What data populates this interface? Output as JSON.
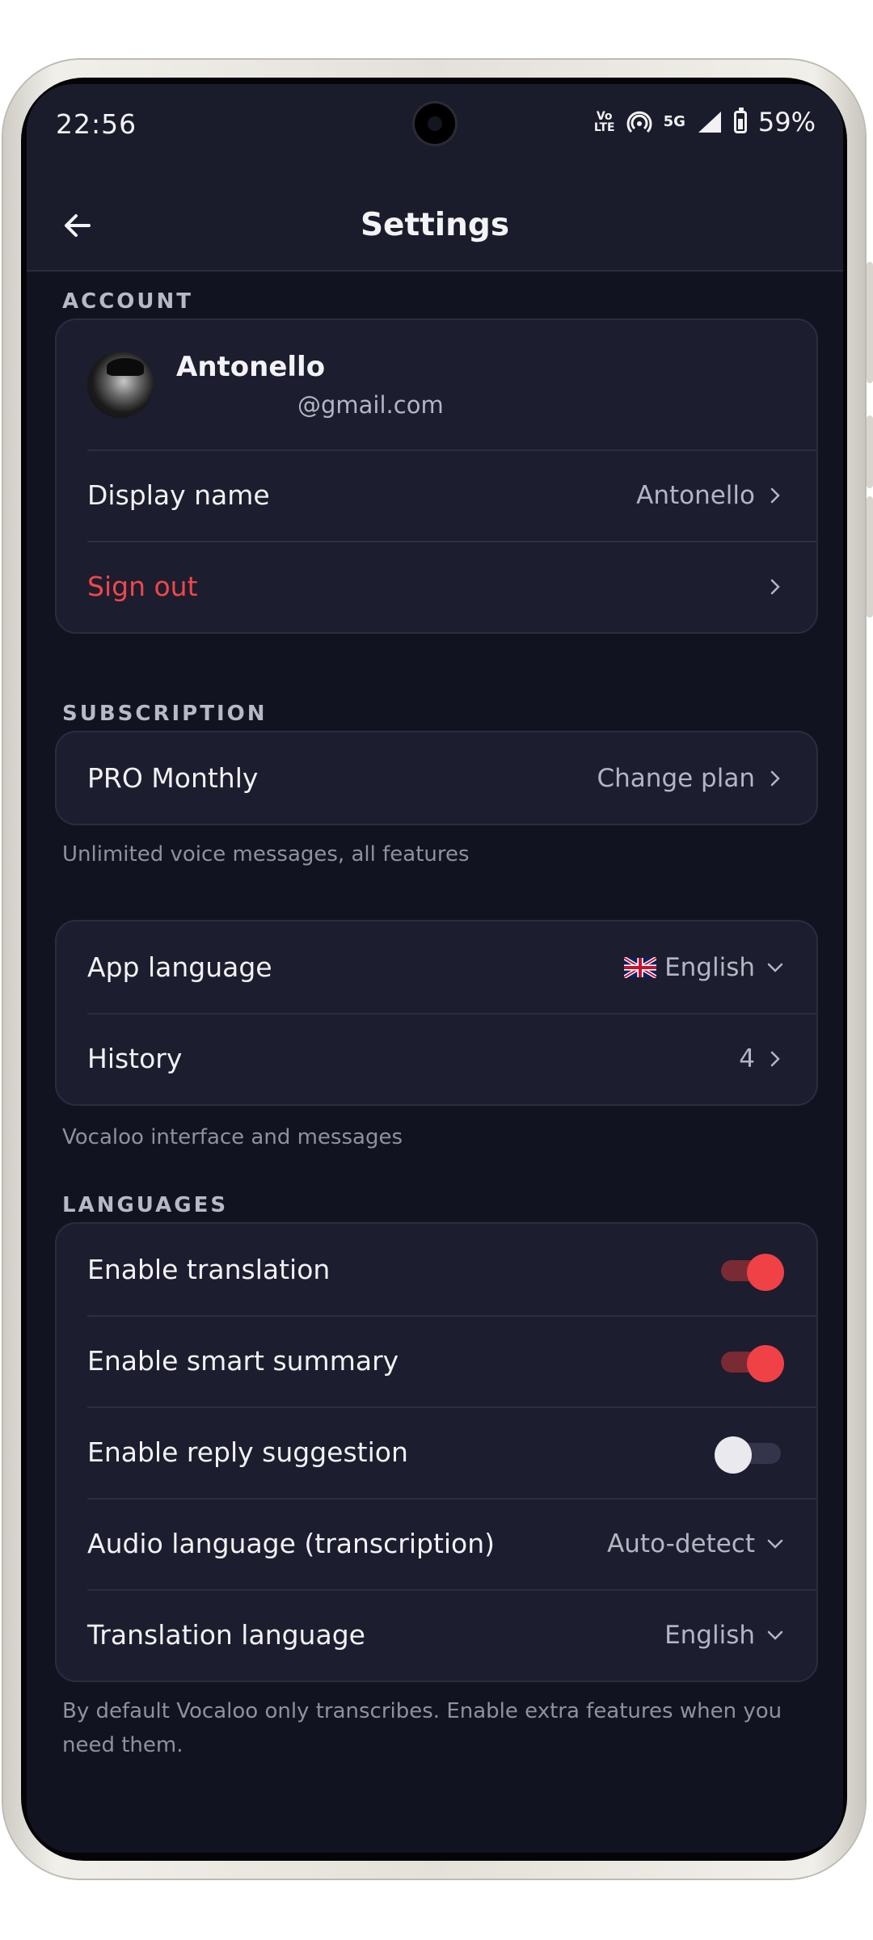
{
  "status_bar": {
    "time": "22:56",
    "network_top": "Vo",
    "network_bottom": "LTE",
    "network_gen": "5G",
    "battery": "59%"
  },
  "app_bar": {
    "title": "Settings"
  },
  "account": {
    "section_label": "ACCOUNT",
    "name": "Antonello",
    "email": "@gmail.com",
    "display_name_label": "Display name",
    "display_name_value": "Antonello",
    "sign_out_label": "Sign out"
  },
  "subscription": {
    "section_label": "SUBSCRIPTION",
    "plan_label": "PRO Monthly",
    "change_plan": "Change plan",
    "note": "Unlimited voice messages, all features"
  },
  "general": {
    "app_language_label": "App language",
    "app_language_value": "English",
    "history_label": "History",
    "history_count": "4",
    "note": "Vocaloo interface and messages"
  },
  "languages": {
    "section_label": "LANGUAGES",
    "enable_translation": "Enable translation",
    "enable_translation_on": true,
    "enable_summary": "Enable smart summary",
    "enable_summary_on": true,
    "enable_reply": "Enable reply suggestion",
    "enable_reply_on": false,
    "audio_language_label": "Audio language (transcription)",
    "audio_language_value": "Auto-detect",
    "translation_language_label": "Translation language",
    "translation_language_value": "English",
    "note": "By default Vocaloo only transcribes. Enable extra features when you need them."
  },
  "colors": {
    "accent": "#ef4146",
    "background": "#121320",
    "card": "#1c1d2e"
  }
}
